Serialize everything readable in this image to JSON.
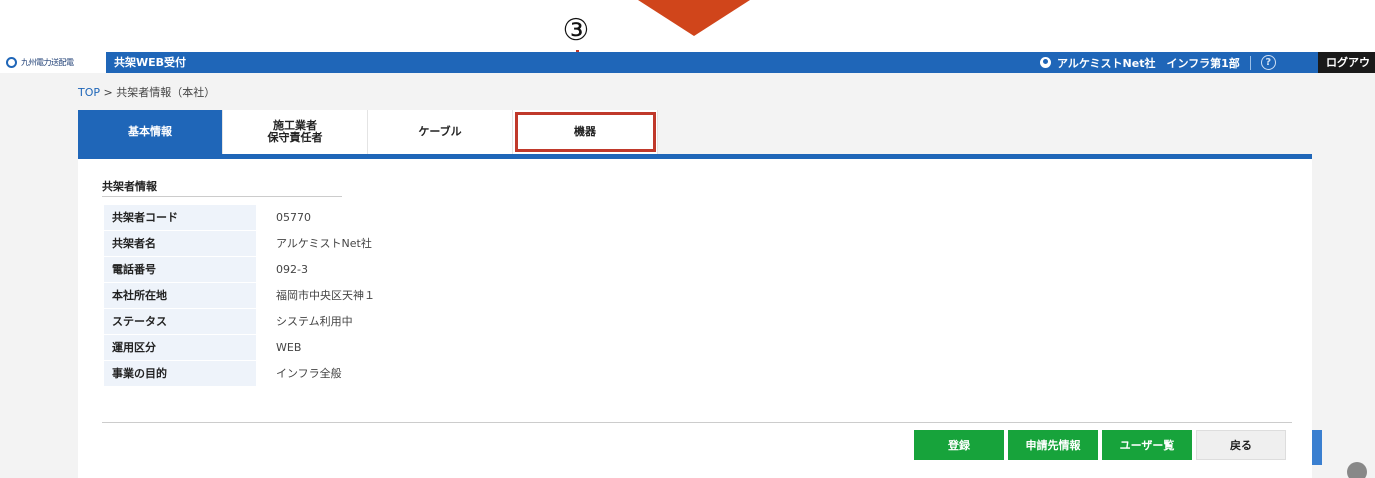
{
  "annotation": {
    "marker": "③"
  },
  "header": {
    "logo_text": "九州電力送配電",
    "app_title": "共架WEB受付",
    "user_label": "アルケミストNet社　インフラ第1部",
    "help_label": "?",
    "logout_label": "ログアウ"
  },
  "breadcrumb": {
    "home": "TOP",
    "separator": " > ",
    "current": "共架者情報（本社）"
  },
  "tabs": [
    {
      "label": "基本情報"
    },
    {
      "label": "施工業者\n保守責任者"
    },
    {
      "label": "ケーブル"
    },
    {
      "label": "機器"
    }
  ],
  "section": {
    "title": "共架者情報"
  },
  "info_rows": [
    {
      "label": "共架者コード",
      "value": "05770"
    },
    {
      "label": "共架者名",
      "value": "アルケミストNet社"
    },
    {
      "label": "電話番号",
      "value": "092-3"
    },
    {
      "label": "本社所在地",
      "value": "福岡市中央区天神１"
    },
    {
      "label": "ステータス",
      "value": "システム利用中"
    },
    {
      "label": "運用区分",
      "value": "WEB"
    },
    {
      "label": "事業の目的",
      "value": "インフラ全般"
    }
  ],
  "actions": {
    "register": "登録",
    "applicant_info": "申請先情報",
    "user_list": "ユーザー覧",
    "back": "戻る"
  }
}
